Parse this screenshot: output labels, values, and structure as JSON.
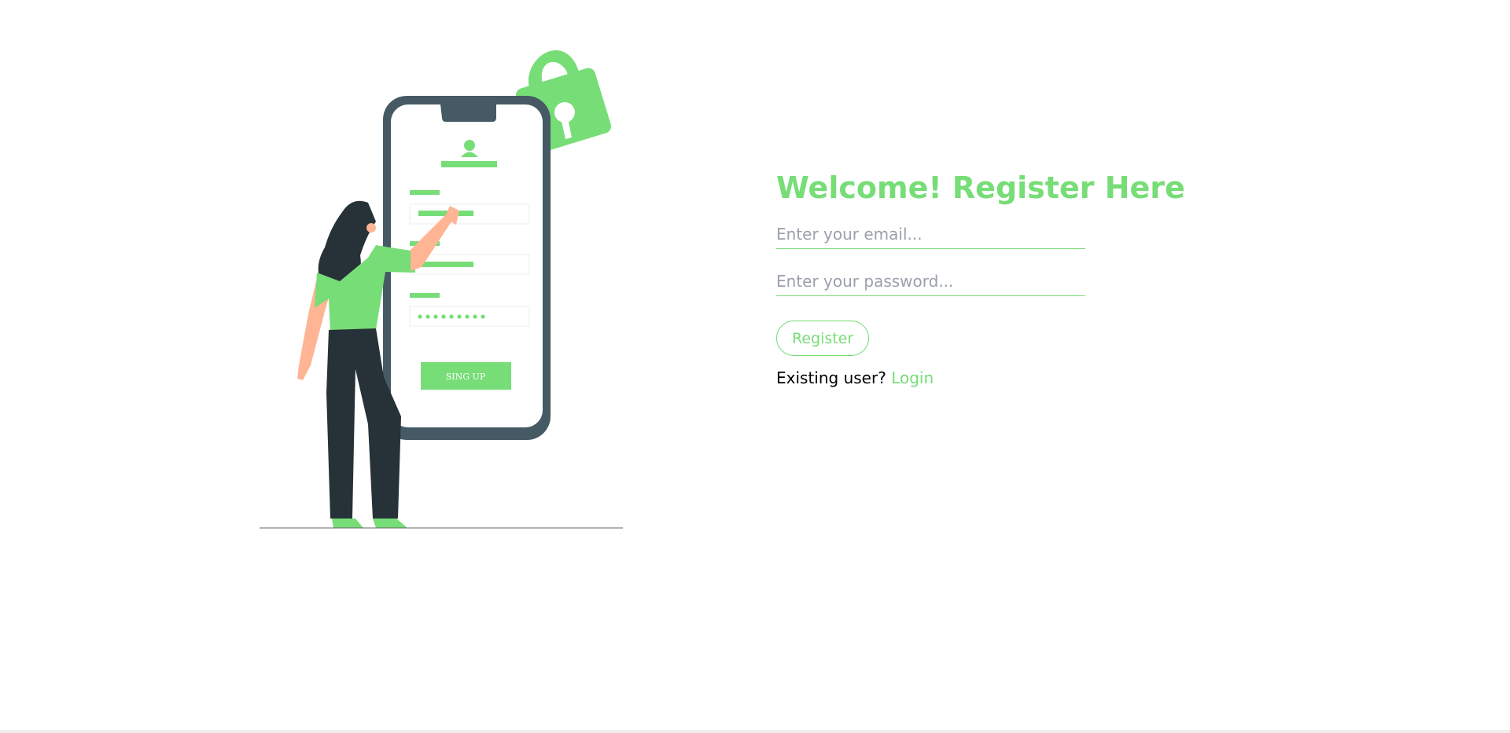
{
  "illustration": {
    "phone_button_label": "SING UP"
  },
  "form": {
    "heading": "Welcome! Register Here",
    "email_placeholder": "Enter your email...",
    "password_placeholder": "Enter your password...",
    "register_label": "Register",
    "existing_user_text": "Existing user?",
    "login_label": "Login"
  },
  "colors": {
    "accent": "#77dd77",
    "phone_frame": "#455a64",
    "pants": "#263238",
    "skin": "#ffb594",
    "placeholder": "#9aa0ab"
  }
}
